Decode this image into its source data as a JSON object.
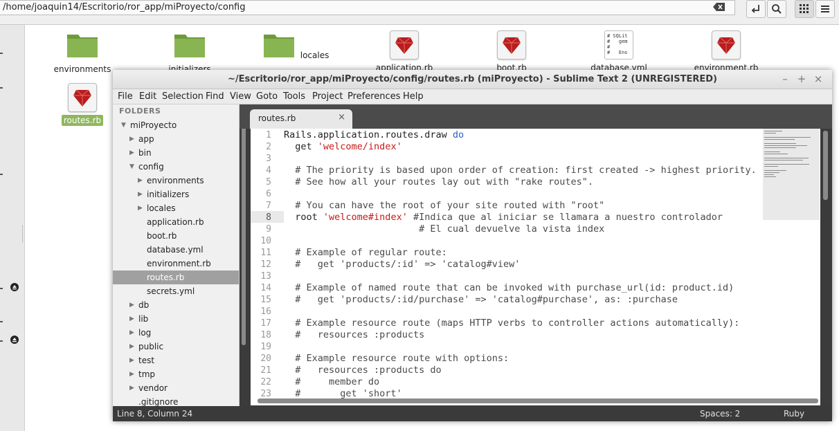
{
  "file_manager": {
    "path": "/home/joaquin14/Escritorio/ror_app/miProyecto/config",
    "icons": [
      {
        "label": "environments",
        "type": "folder"
      },
      {
        "label": "initializers",
        "type": "folder"
      },
      {
        "label": "locales",
        "type": "folder"
      },
      {
        "label": "application.rb",
        "type": "ruby"
      },
      {
        "label": "boot.rb",
        "type": "ruby"
      },
      {
        "label": "database.yml",
        "type": "yml"
      },
      {
        "label": "environment.rb",
        "type": "ruby"
      },
      {
        "label": "routes.rb",
        "type": "ruby",
        "selected": true
      }
    ],
    "yml_preview": "# SQLit\n#   gem\n#\n#   Ens"
  },
  "sublime": {
    "title": "~/Escritorio/ror_app/miProyecto/config/routes.rb (miProyecto) - Sublime Text 2 (UNREGISTERED)",
    "menu": [
      "File",
      "Edit",
      "Selection",
      "Find",
      "View",
      "Goto",
      "Tools",
      "Project",
      "Preferences",
      "Help"
    ],
    "sidebar_header": "FOLDERS",
    "tree": [
      {
        "label": "miProyecto",
        "depth": 0,
        "arrow": "down"
      },
      {
        "label": "app",
        "depth": 1,
        "arrow": "right"
      },
      {
        "label": "bin",
        "depth": 1,
        "arrow": "right"
      },
      {
        "label": "config",
        "depth": 1,
        "arrow": "down"
      },
      {
        "label": "environments",
        "depth": 2,
        "arrow": "right"
      },
      {
        "label": "initializers",
        "depth": 2,
        "arrow": "right"
      },
      {
        "label": "locales",
        "depth": 2,
        "arrow": "right"
      },
      {
        "label": "application.rb",
        "depth": 2,
        "arrow": ""
      },
      {
        "label": "boot.rb",
        "depth": 2,
        "arrow": ""
      },
      {
        "label": "database.yml",
        "depth": 2,
        "arrow": ""
      },
      {
        "label": "environment.rb",
        "depth": 2,
        "arrow": ""
      },
      {
        "label": "routes.rb",
        "depth": 2,
        "arrow": "",
        "selected": true
      },
      {
        "label": "secrets.yml",
        "depth": 2,
        "arrow": ""
      },
      {
        "label": "db",
        "depth": 1,
        "arrow": "right"
      },
      {
        "label": "lib",
        "depth": 1,
        "arrow": "right"
      },
      {
        "label": "log",
        "depth": 1,
        "arrow": "right"
      },
      {
        "label": "public",
        "depth": 1,
        "arrow": "right"
      },
      {
        "label": "test",
        "depth": 1,
        "arrow": "right"
      },
      {
        "label": "tmp",
        "depth": 1,
        "arrow": "right"
      },
      {
        "label": "vendor",
        "depth": 1,
        "arrow": "right"
      },
      {
        "label": ".gitignore",
        "depth": 1,
        "arrow": ""
      }
    ],
    "tab": {
      "name": "routes.rb",
      "close": "×"
    },
    "code_lines": [
      {
        "n": "1",
        "t": "Rails.application.routes.draw do"
      },
      {
        "n": "2",
        "t": "  get 'welcome/index'"
      },
      {
        "n": "3",
        "t": ""
      },
      {
        "n": "4",
        "t": "  # The priority is based upon order of creation: first created -> highest priority."
      },
      {
        "n": "5",
        "t": "  # See how all your routes lay out with \"rake routes\"."
      },
      {
        "n": "6",
        "t": ""
      },
      {
        "n": "7",
        "t": "  # You can have the root of your site routed with \"root\""
      },
      {
        "n": "8",
        "t": "  root 'welcome#index' #Indica que al iniciar se llamara a nuestro controlador"
      },
      {
        "n": "9",
        "t": "                        # El cual devuelve la vista index"
      },
      {
        "n": "10",
        "t": ""
      },
      {
        "n": "11",
        "t": "  # Example of regular route:"
      },
      {
        "n": "12",
        "t": "  #   get 'products/:id' => 'catalog#view'"
      },
      {
        "n": "13",
        "t": ""
      },
      {
        "n": "14",
        "t": "  # Example of named route that can be invoked with purchase_url(id: product.id)"
      },
      {
        "n": "15",
        "t": "  #   get 'products/:id/purchase' => 'catalog#purchase', as: :purchase"
      },
      {
        "n": "16",
        "t": ""
      },
      {
        "n": "17",
        "t": "  # Example resource route (maps HTTP verbs to controller actions automatically):"
      },
      {
        "n": "18",
        "t": "  #   resources :products"
      },
      {
        "n": "19",
        "t": ""
      },
      {
        "n": "20",
        "t": "  # Example resource route with options:"
      },
      {
        "n": "21",
        "t": "  #   resources :products do"
      },
      {
        "n": "22",
        "t": "  #     member do"
      },
      {
        "n": "23",
        "t": "  #       get 'short'"
      }
    ],
    "current_line": "8",
    "status": {
      "position": "Line 8, Column 24",
      "spaces": "Spaces: 2",
      "syntax": "Ruby"
    }
  }
}
